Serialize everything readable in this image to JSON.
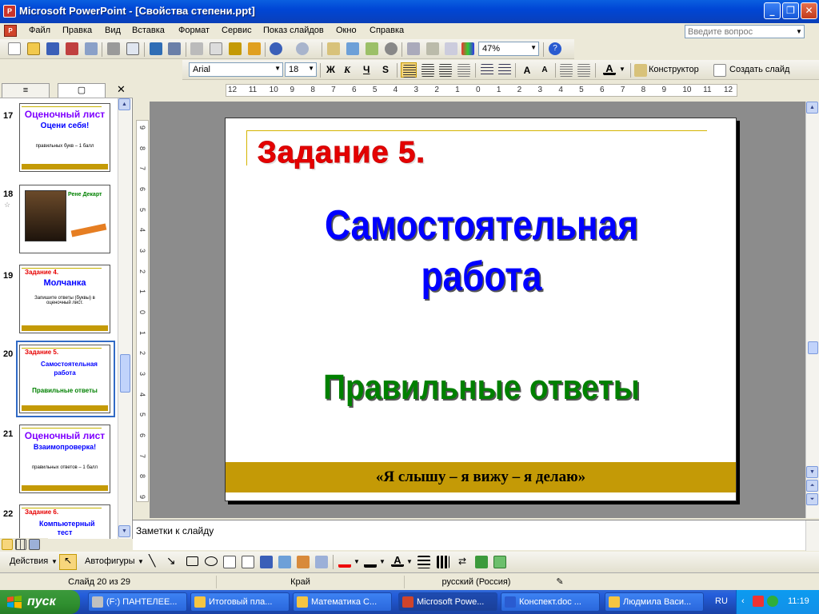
{
  "window": {
    "title": "Microsoft PowerPoint - [Свойства степени.ppt]",
    "app_badge": "P"
  },
  "menu": {
    "items": [
      "Файл",
      "Правка",
      "Вид",
      "Вставка",
      "Формат",
      "Сервис",
      "Показ слайдов",
      "Окно",
      "Справка"
    ],
    "help_placeholder": "Введите вопрос"
  },
  "toolbar": {
    "zoom": "47%"
  },
  "format_bar": {
    "font": "Arial",
    "size": "18",
    "bold": "Ж",
    "italic": "К",
    "underline": "Ч",
    "shadow": "S",
    "designer": "Конструктор",
    "new_slide": "Создать слайд"
  },
  "ruler": {
    "labels": [
      "12",
      "11",
      "10",
      "9",
      "8",
      "7",
      "6",
      "5",
      "4",
      "3",
      "2",
      "1",
      "0",
      "1",
      "2",
      "3",
      "4",
      "5",
      "6",
      "7",
      "8",
      "9",
      "10",
      "11",
      "12"
    ]
  },
  "vruler": {
    "labels": [
      "9",
      "8",
      "7",
      "6",
      "5",
      "4",
      "3",
      "2",
      "1",
      "0",
      "1",
      "2",
      "3",
      "4",
      "5",
      "6",
      "7",
      "8",
      "9"
    ]
  },
  "thumbnails": [
    {
      "num": "17",
      "title": "Оценочный лист",
      "sub1": "Оцени себя!",
      "sub2": "правильных букв – 1 балл",
      "title_color": "#7f00ff"
    },
    {
      "num": "18",
      "title": "Рене Декарт",
      "sub1": "",
      "sub2": "",
      "title_color": "#008000"
    },
    {
      "num": "19",
      "title": "Задание 4.",
      "sub1": "Молчанка",
      "sub2": "Запишите ответы (буквы) в оценочный лист.",
      "title_color": "#e60000"
    },
    {
      "num": "20",
      "title": "Задание 5.",
      "sub1": "Самостоятельная работа",
      "sub2": "Правильные ответы",
      "title_color": "#e60000"
    },
    {
      "num": "21",
      "title": "Оценочный лист",
      "sub1": "Взаимопроверка!",
      "sub2": "правильных ответов – 1 балл",
      "title_color": "#7f00ff"
    },
    {
      "num": "22",
      "title": "Задание 6.",
      "sub1": "Компьютерный тест",
      "sub2": "",
      "title_color": "#e60000"
    }
  ],
  "slide": {
    "title": "Задание 5.",
    "line1": "Самостоятельная",
    "line2": "работа",
    "answers": "Правильные ответы",
    "footer": "«Я слышу – я вижу – я делаю»"
  },
  "notes": {
    "label": "Заметки к слайду"
  },
  "drawing": {
    "actions": "Действия",
    "autoshapes": "Автофигуры"
  },
  "status": {
    "slide": "Слайд 20 из 29",
    "design": "Край",
    "language": "русский (Россия)"
  },
  "taskbar": {
    "start": "пуск",
    "tasks": [
      {
        "label": "(F:) ПАНТЕЛЕЕ...",
        "color": "#c0c0c0"
      },
      {
        "label": "Итоговый пла...",
        "color": "#f5c542"
      },
      {
        "label": "Математика С...",
        "color": "#f5c542"
      },
      {
        "label": "Microsoft Powe...",
        "color": "#d0442a"
      },
      {
        "label": "Конспект.doc ...",
        "color": "#2a5bd0"
      },
      {
        "label": "Людмила Васи...",
        "color": "#f5c542"
      }
    ],
    "lang": "RU",
    "time": "11:19"
  }
}
